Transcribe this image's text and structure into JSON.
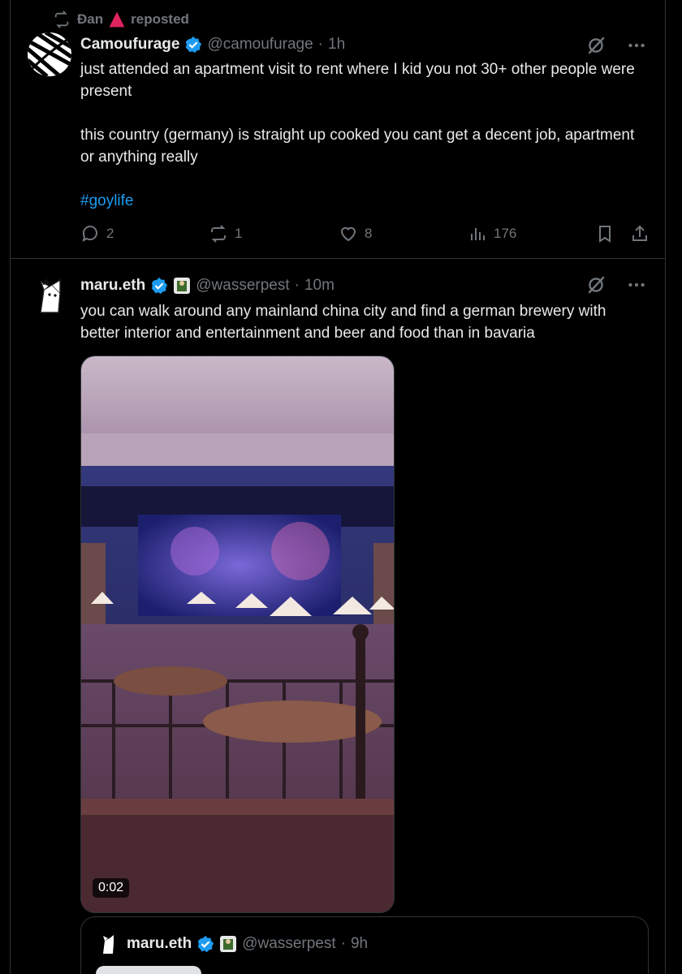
{
  "repost": {
    "user": "Đan",
    "label": "reposted"
  },
  "tweet1": {
    "display_name": "Camoufurage",
    "handle": "@camoufurage",
    "separator": "·",
    "time": "1h",
    "text_p1": "just attended an apartment visit to rent where I kid you not 30+ other people were present",
    "text_p2": "this country (germany) is straight up cooked you cant get a decent job, apartment or anything really",
    "hashtag": "#goylife",
    "replies": "2",
    "reposts": "1",
    "likes": "8",
    "views": "176"
  },
  "tweet2": {
    "display_name": "maru.eth",
    "handle": "@wasserpest",
    "separator": "·",
    "time": "10m",
    "text": "you can walk around any mainland china city and find a german brewery with better interior and entertainment and beer and food than in bavaria",
    "video_duration": "0:02"
  },
  "quote": {
    "display_name": "maru.eth",
    "handle": "@wasserpest",
    "separator": "·",
    "time": "9h"
  },
  "colors": {
    "accent": "#1d9bf0",
    "muted": "#71767b",
    "background": "#000000",
    "text": "#e7e9ea"
  }
}
